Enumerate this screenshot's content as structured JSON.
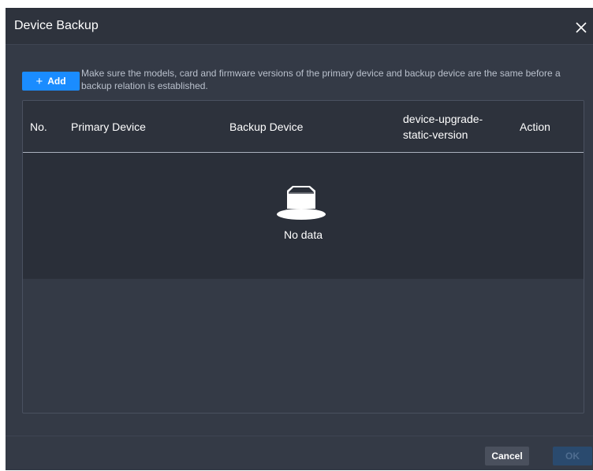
{
  "dialog": {
    "title": "Device Backup"
  },
  "toolbar": {
    "add_label": "Add",
    "add_icon": "plus-icon",
    "note_line1": "Make sure the models, card and firmware versions of the primary device and backup device are the same before a",
    "note_line2": "backup relation is established."
  },
  "table": {
    "columns": [
      {
        "label": "No."
      },
      {
        "label": "Primary Device"
      },
      {
        "label": "Backup Device"
      },
      {
        "label_line1": "device-upgrade-",
        "label_line2": "static-version"
      },
      {
        "label": "Action"
      }
    ],
    "rows": [],
    "empty_text": "No data"
  },
  "footer": {
    "cancel_label": "Cancel",
    "ok_label": "OK"
  },
  "colors": {
    "accent": "#1a8cff",
    "dialog_bg": "#343a46",
    "table_body_bg": "#2a2f39"
  }
}
